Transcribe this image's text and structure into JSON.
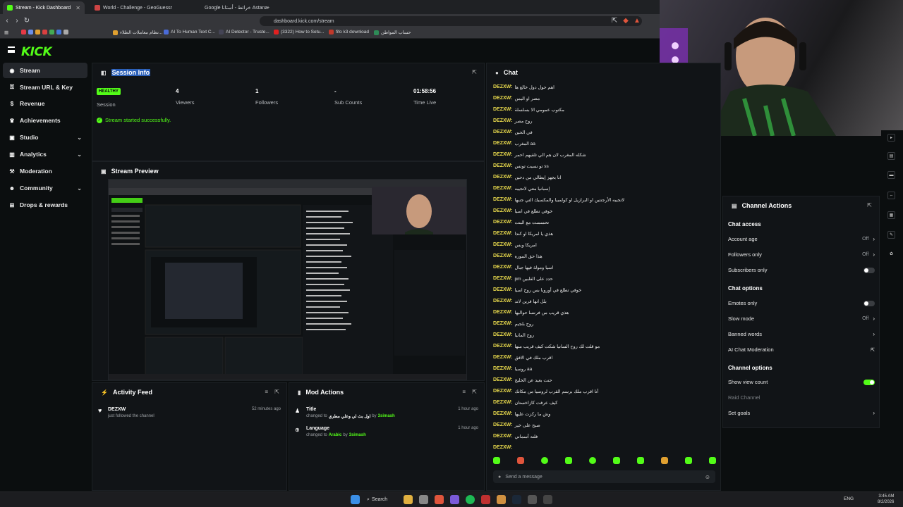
{
  "browser": {
    "tabs": [
      {
        "title": "Stream - Kick Dashboard",
        "active": true
      },
      {
        "title": "World - Challenge - GeoGuessr",
        "active": false
      },
      {
        "title": "Google خرائط - أستانا Astana",
        "active": false
      }
    ],
    "url": "dashboard.kick.com/stream",
    "bookmarks": [
      "نظام معاملات الطلاء...",
      "AI To Human Text C...",
      "AI Detector - Truste...",
      "(3322) How to Setu...",
      "fifo k3 download",
      "حساب المواطن"
    ]
  },
  "app": {
    "logo": "KICK"
  },
  "sidebar": {
    "items": [
      {
        "label": "Stream",
        "icon": "broadcast-icon",
        "active": true,
        "expandable": false
      },
      {
        "label": "Stream URL & Key",
        "icon": "key-icon",
        "expandable": false
      },
      {
        "label": "Revenue",
        "icon": "dollar-icon",
        "expandable": false
      },
      {
        "label": "Achievements",
        "icon": "trophy-icon",
        "expandable": false
      },
      {
        "label": "Studio",
        "icon": "studio-icon",
        "expandable": true
      },
      {
        "label": "Analytics",
        "icon": "analytics-icon",
        "expandable": true
      },
      {
        "label": "Moderation",
        "icon": "moderation-icon",
        "expandable": false
      },
      {
        "label": "Community",
        "icon": "community-icon",
        "expandable": true
      },
      {
        "label": "Drops & rewards",
        "icon": "gift-icon",
        "expandable": false
      }
    ]
  },
  "session": {
    "title": "Session Info",
    "badge": "HEALTHY",
    "stats": [
      {
        "value": "",
        "label": "Session"
      },
      {
        "value": "4",
        "label": "Viewers"
      },
      {
        "value": "1",
        "label": "Followers"
      },
      {
        "value": "-",
        "label": "Sub Counts"
      },
      {
        "value": "01:58:56",
        "label": "Time Live"
      }
    ],
    "status": "Stream started successfully."
  },
  "preview": {
    "title": "Stream Preview"
  },
  "activity": {
    "title": "Activity Feed",
    "items": [
      {
        "user": "DEZXW",
        "text": "just followed the channel",
        "time": "52 minutes ago"
      }
    ]
  },
  "mod_actions": {
    "title": "Mod Actions",
    "items": [
      {
        "field": "Title",
        "text_prefix": "changed to",
        "value": "اول بث لي وعلي مطري",
        "by": "by",
        "user": "3simash",
        "time": "1 hour ago"
      },
      {
        "field": "Language",
        "text_prefix": "changed to",
        "value": "Arabic",
        "by": "by",
        "user": "3simash",
        "time": "1 hour ago"
      }
    ]
  },
  "chat": {
    "title": "Chat",
    "username": "DEZXW:",
    "messages": [
      "اهم حول دول خالع ها",
      "مصر او اليمن",
      "مكتوب عمومي الا بسلسلة",
      "روح مصر",
      "في الحين",
      "المغرب aa",
      "شكله المغرب لان هم الي تلقيهم احمر",
      "تو نسيت تونس ss",
      "انا بجهز إيطالي من دحين",
      "إسبانيا معي لاتجيبه",
      "لاتجيبه الأرجنتين او البرازيل او كولمبيا والمكسيك التي جنبها",
      "خوفي تطلع في اسيا",
      "تحسست مع البنت",
      "هذي يا امريكا او كندا",
      "امريكا وبس",
      "هذا حق الموره",
      "اسيا ومولة فيها جبال",
      "pm حدد على الفلبين",
      "خوفي تطلع في أوروبا بس روح اسيا",
      "بلل انها فرين لاند",
      "هذي قريب من فرنسا حواليها",
      "روح بلجيم",
      "روح المانيا",
      "مو قلت لك روح السانيا شكت كيف قريب منها",
      "اقرب ملك في الافق",
      "روسيا aa",
      "حنت بعيد عن الخليج",
      "أنا اقرب ملك برسم القرب لروسيا من مكانك",
      "كيف عرفت كازاخستان",
      "وش ما ركزت عليها",
      "صبح على خير",
      "فلته أسماني",
      ""
    ],
    "input_placeholder": "Send a message"
  },
  "channel_actions": {
    "title": "Channel Actions",
    "chat_access": {
      "title": "Chat access",
      "rows": [
        {
          "label": "Account age",
          "value": "Off"
        },
        {
          "label": "Followers only",
          "value": "Off"
        },
        {
          "label": "Subscribers only",
          "value": ""
        }
      ]
    },
    "chat_options": {
      "title": "Chat options",
      "rows": [
        {
          "label": "Emotes only",
          "value": ""
        },
        {
          "label": "Slow mode",
          "value": "Off"
        },
        {
          "label": "Banned words",
          "value": ""
        },
        {
          "label": "AI Chat Moderation",
          "value": ""
        }
      ]
    },
    "channel_options": {
      "title": "Channel options",
      "rows": [
        {
          "label": "Show view count",
          "value": ""
        },
        {
          "label": "Raid Channel",
          "value": ""
        },
        {
          "label": "Set goals",
          "value": ""
        }
      ]
    }
  },
  "taskbar": {
    "search": "Search",
    "lang": "ENG",
    "time": "3:45 AM",
    "date": "8/2/2026"
  },
  "colors": {
    "accent": "#53fc18",
    "bg": "#0b0e0f",
    "panel": "#111417",
    "username": "#e7d84c"
  }
}
